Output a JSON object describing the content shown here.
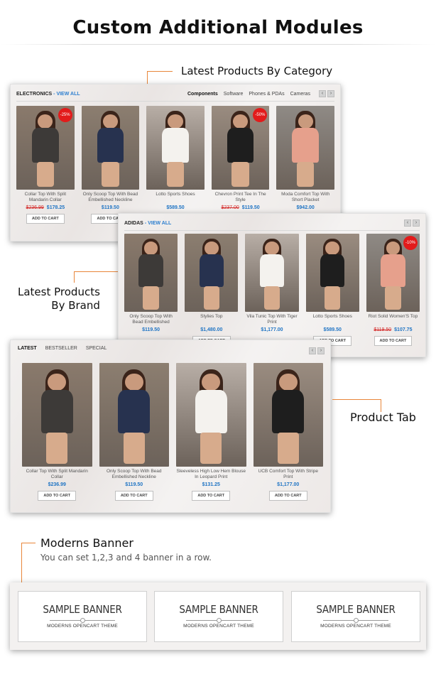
{
  "page": {
    "title": "Custom Additional Modules"
  },
  "callouts": {
    "latest_category": "Latest Products By Category",
    "latest_brand_line1": "Latest Products",
    "latest_brand_line2": "By Brand",
    "product_tab": "Product Tab",
    "moderns_banner": "Moderns Banner",
    "moderns_banner_desc": "You can set 1,2,3 and 4 banner in a row."
  },
  "category_module": {
    "title": "ELECTRONICS",
    "view_all": "- VIEW ALL",
    "tabs": [
      "Components",
      "Software",
      "Phones & PDAs",
      "Cameras"
    ],
    "active_tab": "Components",
    "products": [
      {
        "name": "Collar Top With Split Mandarin Collar",
        "old_price": "$236.99",
        "price": "$178.25",
        "badge": "-25%",
        "button": "ADD TO CART"
      },
      {
        "name": "Only Scoop Top With Bead Embellished Neckline",
        "old_price": "",
        "price": "$119.50",
        "badge": "",
        "button": "ADD TO CART"
      },
      {
        "name": "Lotto Sports Shoes",
        "old_price": "",
        "price": "$589.50",
        "badge": "",
        "button": ""
      },
      {
        "name": "Chevron Print Tee In The Style",
        "old_price": "$237.00",
        "price": "$119.50",
        "badge": "-50%",
        "button": ""
      },
      {
        "name": "Moda Comfort Top With Short Placket",
        "old_price": "",
        "price": "$942.00",
        "badge": "",
        "button": ""
      }
    ]
  },
  "brand_module": {
    "title": "ADIDAS",
    "view_all": "- VIEW ALL",
    "products": [
      {
        "name": "Only Scoop Top With Bead Embellished Neckline",
        "old_price": "",
        "price": "$119.50",
        "badge": "",
        "button": ""
      },
      {
        "name": "Stylies Top",
        "old_price": "",
        "price": "$1,480.00",
        "badge": "",
        "button": "ADD TO CART"
      },
      {
        "name": "Vila Tunic Top With Tiger Print",
        "old_price": "",
        "price": "$1,177.00",
        "badge": "",
        "button": ""
      },
      {
        "name": "Lotto Sports Shoes",
        "old_price": "",
        "price": "$589.50",
        "badge": "",
        "button": "ADD TO CART"
      },
      {
        "name": "Riot Solid Women'S Top",
        "old_price": "$119.50",
        "price": "$107.75",
        "badge": "-10%",
        "button": "ADD TO CART"
      }
    ]
  },
  "tab_module": {
    "tabs": [
      "LATEST",
      "BESTSELLER",
      "SPECIAL"
    ],
    "active_tab": "LATEST",
    "products": [
      {
        "name": "Collar Top With Split Mandarin Collar",
        "old_price": "",
        "price": "$236.99",
        "badge": "",
        "button": "ADD TO CART"
      },
      {
        "name": "Only Scoop Top With Bead Embellished Neckline",
        "old_price": "",
        "price": "$119.50",
        "badge": "",
        "button": "ADD TO CART"
      },
      {
        "name": "Sleeveless High Low Hem Blouse In Leopard Print",
        "old_price": "",
        "price": "$131.25",
        "badge": "",
        "button": "ADD TO CART"
      },
      {
        "name": "UCB Comfort Top With Stripe Print",
        "old_price": "",
        "price": "$1,177.00",
        "badge": "",
        "button": "ADD TO CART"
      }
    ]
  },
  "banners": [
    {
      "title": "SAMPLE BANNER",
      "subtitle": "MODERNS OPENCART THEME"
    },
    {
      "title": "SAMPLE BANNER",
      "subtitle": "MODERNS OPENCART THEME"
    },
    {
      "title": "SAMPLE BANNER",
      "subtitle": "MODERNS OPENCART THEME"
    }
  ],
  "colors": {
    "accent": "#e8863a",
    "price": "#1f74c4",
    "sale": "#e21b1b"
  },
  "icons": {
    "prev": "chevron-left-icon",
    "next": "chevron-right-icon"
  }
}
